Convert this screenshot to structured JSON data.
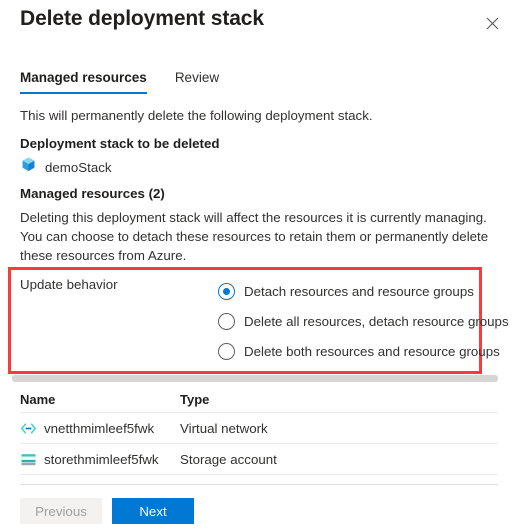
{
  "dialog": {
    "title": "Delete deployment stack",
    "close_icon": "close-icon"
  },
  "tabs": [
    {
      "label": "Managed resources",
      "active": true
    },
    {
      "label": "Review",
      "active": false
    }
  ],
  "content": {
    "intro": "This will permanently delete the following deployment stack.",
    "stack_heading": "Deployment stack to be deleted",
    "stack_name": "demoStack",
    "stack_icon": "deployment-stack-icon",
    "managed_heading": "Managed resources (2)",
    "description": "Deleting this deployment stack will affect the resources it is currently managing. You can choose to detach these resources to retain them or permanently delete these resources from Azure."
  },
  "update_behavior": {
    "label": "Update behavior",
    "highlight_color": "#fb3b3b",
    "accent_color": "#0078d4",
    "options": [
      {
        "label": "Detach resources and resource groups",
        "selected": true
      },
      {
        "label": "Delete all resources, detach resource groups",
        "selected": false
      },
      {
        "label": "Delete both resources and resource groups",
        "selected": false
      }
    ]
  },
  "table": {
    "columns": [
      "Name",
      "Type"
    ],
    "rows": [
      {
        "name": "vnetthmimleef5fwk",
        "type": "Virtual network",
        "icon": "virtual-network-icon"
      },
      {
        "name": "storethmimleef5fwk",
        "type": "Storage account",
        "icon": "storage-account-icon"
      }
    ]
  },
  "footer": {
    "previous_label": "Previous",
    "next_label": "Next"
  }
}
